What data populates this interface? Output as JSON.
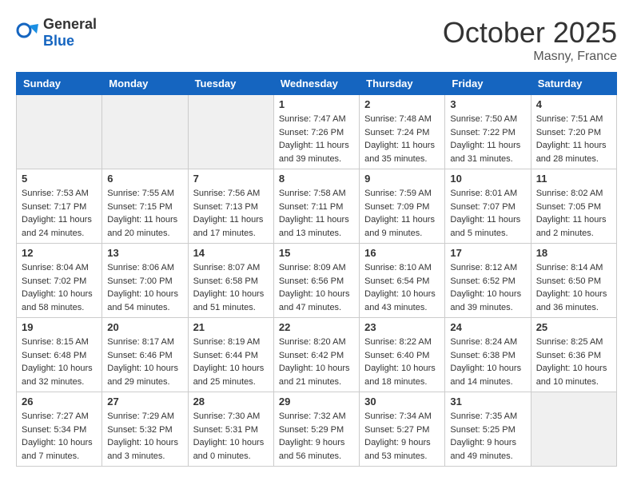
{
  "header": {
    "logo_general": "General",
    "logo_blue": "Blue",
    "title": "October 2025",
    "location": "Masny, France"
  },
  "weekdays": [
    "Sunday",
    "Monday",
    "Tuesday",
    "Wednesday",
    "Thursday",
    "Friday",
    "Saturday"
  ],
  "weeks": [
    [
      {
        "day": "",
        "info": "",
        "shade": true
      },
      {
        "day": "",
        "info": "",
        "shade": true
      },
      {
        "day": "",
        "info": "",
        "shade": true
      },
      {
        "day": "1",
        "info": "Sunrise: 7:47 AM\nSunset: 7:26 PM\nDaylight: 11 hours\nand 39 minutes."
      },
      {
        "day": "2",
        "info": "Sunrise: 7:48 AM\nSunset: 7:24 PM\nDaylight: 11 hours\nand 35 minutes."
      },
      {
        "day": "3",
        "info": "Sunrise: 7:50 AM\nSunset: 7:22 PM\nDaylight: 11 hours\nand 31 minutes."
      },
      {
        "day": "4",
        "info": "Sunrise: 7:51 AM\nSunset: 7:20 PM\nDaylight: 11 hours\nand 28 minutes."
      }
    ],
    [
      {
        "day": "5",
        "info": "Sunrise: 7:53 AM\nSunset: 7:17 PM\nDaylight: 11 hours\nand 24 minutes."
      },
      {
        "day": "6",
        "info": "Sunrise: 7:55 AM\nSunset: 7:15 PM\nDaylight: 11 hours\nand 20 minutes."
      },
      {
        "day": "7",
        "info": "Sunrise: 7:56 AM\nSunset: 7:13 PM\nDaylight: 11 hours\nand 17 minutes."
      },
      {
        "day": "8",
        "info": "Sunrise: 7:58 AM\nSunset: 7:11 PM\nDaylight: 11 hours\nand 13 minutes."
      },
      {
        "day": "9",
        "info": "Sunrise: 7:59 AM\nSunset: 7:09 PM\nDaylight: 11 hours\nand 9 minutes."
      },
      {
        "day": "10",
        "info": "Sunrise: 8:01 AM\nSunset: 7:07 PM\nDaylight: 11 hours\nand 5 minutes."
      },
      {
        "day": "11",
        "info": "Sunrise: 8:02 AM\nSunset: 7:05 PM\nDaylight: 11 hours\nand 2 minutes."
      }
    ],
    [
      {
        "day": "12",
        "info": "Sunrise: 8:04 AM\nSunset: 7:02 PM\nDaylight: 10 hours\nand 58 minutes."
      },
      {
        "day": "13",
        "info": "Sunrise: 8:06 AM\nSunset: 7:00 PM\nDaylight: 10 hours\nand 54 minutes."
      },
      {
        "day": "14",
        "info": "Sunrise: 8:07 AM\nSunset: 6:58 PM\nDaylight: 10 hours\nand 51 minutes."
      },
      {
        "day": "15",
        "info": "Sunrise: 8:09 AM\nSunset: 6:56 PM\nDaylight: 10 hours\nand 47 minutes."
      },
      {
        "day": "16",
        "info": "Sunrise: 8:10 AM\nSunset: 6:54 PM\nDaylight: 10 hours\nand 43 minutes."
      },
      {
        "day": "17",
        "info": "Sunrise: 8:12 AM\nSunset: 6:52 PM\nDaylight: 10 hours\nand 39 minutes."
      },
      {
        "day": "18",
        "info": "Sunrise: 8:14 AM\nSunset: 6:50 PM\nDaylight: 10 hours\nand 36 minutes."
      }
    ],
    [
      {
        "day": "19",
        "info": "Sunrise: 8:15 AM\nSunset: 6:48 PM\nDaylight: 10 hours\nand 32 minutes."
      },
      {
        "day": "20",
        "info": "Sunrise: 8:17 AM\nSunset: 6:46 PM\nDaylight: 10 hours\nand 29 minutes."
      },
      {
        "day": "21",
        "info": "Sunrise: 8:19 AM\nSunset: 6:44 PM\nDaylight: 10 hours\nand 25 minutes."
      },
      {
        "day": "22",
        "info": "Sunrise: 8:20 AM\nSunset: 6:42 PM\nDaylight: 10 hours\nand 21 minutes."
      },
      {
        "day": "23",
        "info": "Sunrise: 8:22 AM\nSunset: 6:40 PM\nDaylight: 10 hours\nand 18 minutes."
      },
      {
        "day": "24",
        "info": "Sunrise: 8:24 AM\nSunset: 6:38 PM\nDaylight: 10 hours\nand 14 minutes."
      },
      {
        "day": "25",
        "info": "Sunrise: 8:25 AM\nSunset: 6:36 PM\nDaylight: 10 hours\nand 10 minutes."
      }
    ],
    [
      {
        "day": "26",
        "info": "Sunrise: 7:27 AM\nSunset: 5:34 PM\nDaylight: 10 hours\nand 7 minutes."
      },
      {
        "day": "27",
        "info": "Sunrise: 7:29 AM\nSunset: 5:32 PM\nDaylight: 10 hours\nand 3 minutes."
      },
      {
        "day": "28",
        "info": "Sunrise: 7:30 AM\nSunset: 5:31 PM\nDaylight: 10 hours\nand 0 minutes."
      },
      {
        "day": "29",
        "info": "Sunrise: 7:32 AM\nSunset: 5:29 PM\nDaylight: 9 hours\nand 56 minutes."
      },
      {
        "day": "30",
        "info": "Sunrise: 7:34 AM\nSunset: 5:27 PM\nDaylight: 9 hours\nand 53 minutes."
      },
      {
        "day": "31",
        "info": "Sunrise: 7:35 AM\nSunset: 5:25 PM\nDaylight: 9 hours\nand 49 minutes."
      },
      {
        "day": "",
        "info": "",
        "shade": true
      }
    ]
  ]
}
